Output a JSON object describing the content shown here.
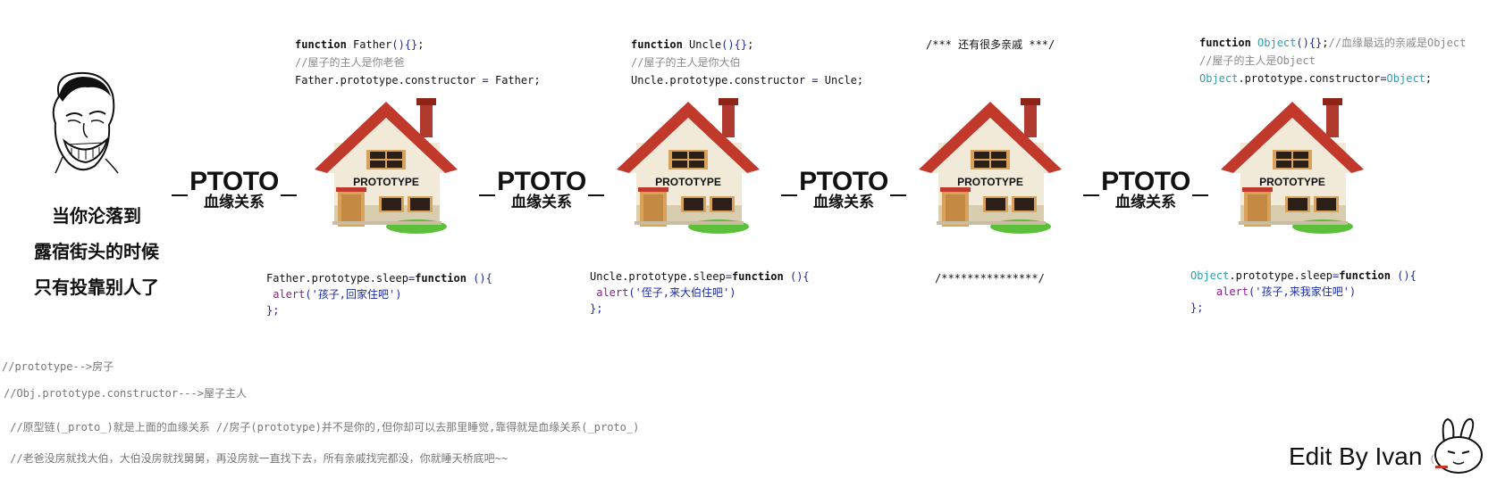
{
  "meme": {
    "caption_lines": [
      "当你沦落到",
      "露宿街头的时候",
      "只有投靠别人了"
    ]
  },
  "link_label": {
    "big": "PTOTO",
    "small": "血缘关系"
  },
  "house_label": "PROTOTYPE",
  "top_code": {
    "father": {
      "line1_kw": "function",
      "line1_rest": " Father",
      "line1_paren": "(){}",
      "line1_end": ";",
      "line2": "//屋子的主人是你老爸",
      "line3_a": "Father.prototype.constructor ",
      "line3_eq": "=",
      "line3_b": " Father;"
    },
    "uncle": {
      "line1_kw": "function",
      "line1_rest": " Uncle",
      "line1_paren": "(){}",
      "line1_end": ";",
      "line2": "//屋子的主人是你大伯",
      "line3_a": "Uncle.prototype.constructor ",
      "line3_eq": "=",
      "line3_b": " Uncle;"
    },
    "relatives": "/*** 还有很多亲戚 ***/",
    "object": {
      "line1_kw": "function",
      "line1_obj": " Object",
      "line1_paren": "(){}",
      "line1_end": ";",
      "line1_cm": "//血缘最远的亲戚是",
      "line1_cm_obj": "Object",
      "line2": "//屋子的主人是",
      "line2_obj": "Object",
      "line3_obj": "Object",
      "line3_mid": ".prototype.constructor",
      "line3_eq": "=",
      "line3_obj2": "Object",
      "line3_end": ";"
    }
  },
  "bottom_code": {
    "father": {
      "line1_a": "Father.prototype.sleep",
      "line1_eq": "=",
      "line1_kw": "function",
      "line1_paren": " (){",
      "line2_alert": " alert",
      "line2_str": "('孩子,回家住吧')",
      "line3": "};"
    },
    "uncle": {
      "line1_a": "Uncle.prototype.sleep",
      "line1_eq": "=",
      "line1_kw": "function",
      "line1_paren": " (){",
      "line2_alert": " alert",
      "line2_str": "('侄子,来大伯住吧')",
      "line3": "};"
    },
    "relatives": "/***************/",
    "object": {
      "line1_obj": "Object",
      "line1_a": ".prototype.sleep",
      "line1_eq": "=",
      "line1_kw": "function",
      "line1_paren": " (){",
      "line2_alert": "    alert",
      "line2_str": "('孩子,来我家住吧')",
      "line3": "};"
    }
  },
  "notes": [
    "//prototype-->房子",
    "//Obj.prototype.constructor--->屋子主人",
    " //原型链(_proto_)就是上面的血缘关系 //房子(prototype)并不是你的,但你却可以去那里睡觉,靠得就是血缘关系(_proto_)",
    " //老爸没房就找大伯，大伯没房就找舅舅，再没房就一直找下去，所有亲戚找完都没，你就睡天桥底吧~~"
  ],
  "signature": "Edit By Ivan",
  "colors": {
    "roof": "#c0392b",
    "roof_dark": "#8e2318",
    "wall": "#f1ead8",
    "wall_shade": "#d9cdb0",
    "door": "#d9a25a",
    "window_frame": "#d9a25a",
    "window_glass": "#2a2018",
    "grass": "#5cbf3a",
    "chimney": "#b03a2e",
    "keyword_blue": "#1a2aa8",
    "alert_purple": "#8b1a8b",
    "object_cyan": "#2a9fb0",
    "comment_gray": "#8a8a8a"
  },
  "icons": [
    "troll-face-icon",
    "house-icon",
    "bunny-smoking-icon"
  ]
}
